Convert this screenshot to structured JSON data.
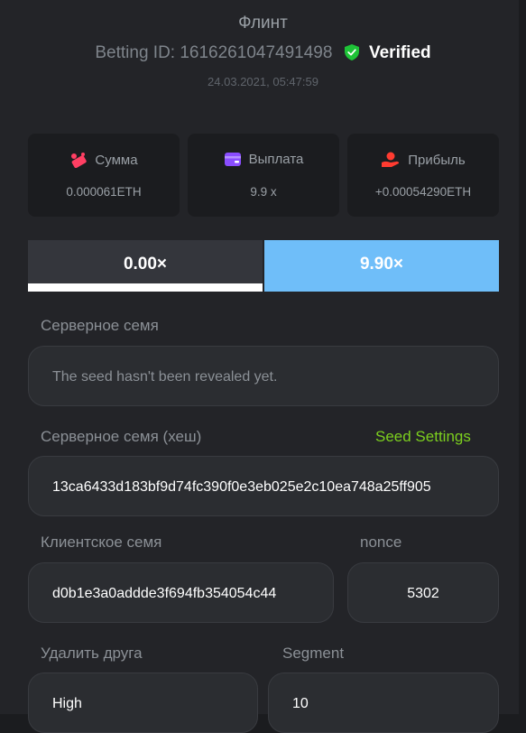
{
  "header": {
    "title": "Флинт",
    "betting_id_label": "Betting ID: 1616261047491498",
    "verified_label": "Verified",
    "date": "24.03.2021, 05:47:59"
  },
  "stats": [
    {
      "label": "Сумма",
      "value": "0.000061ETH",
      "icon": "coins-icon",
      "icon_color": "#ff3f63"
    },
    {
      "label": "Выплата",
      "value": "9.9 x",
      "icon": "wallet-icon",
      "icon_color": "#8a4dff"
    },
    {
      "label": "Прибыль",
      "value": "+0.00054290ETH",
      "icon": "profit-hand-icon",
      "icon_color": "#ff3b30"
    }
  ],
  "tabs": {
    "left_label": "0.00×",
    "right_label": "9.90×",
    "left_progress": 1.0
  },
  "server_seed": {
    "label": "Серверное семя",
    "value": "The seed hasn't been revealed yet."
  },
  "server_hash": {
    "label": "Серверное семя (хеш)",
    "link": "Seed Settings",
    "value": "13ca6433d183bf9d74fc390f0e3eb025e2c10ea748a25ff905"
  },
  "client_seed": {
    "label": "Клиентское семя",
    "value": "d0b1e3a0addde3f694fb354054c44"
  },
  "nonce": {
    "label": "nonce",
    "value": "5302"
  },
  "remove_friend": {
    "label": "Удалить друга",
    "value": "High"
  },
  "segment": {
    "label": "Segment",
    "value": "10"
  },
  "colors": {
    "accent_blue": "#6fbef9",
    "verified_green": "#1ec337",
    "link_green": "#7ccf1e"
  }
}
